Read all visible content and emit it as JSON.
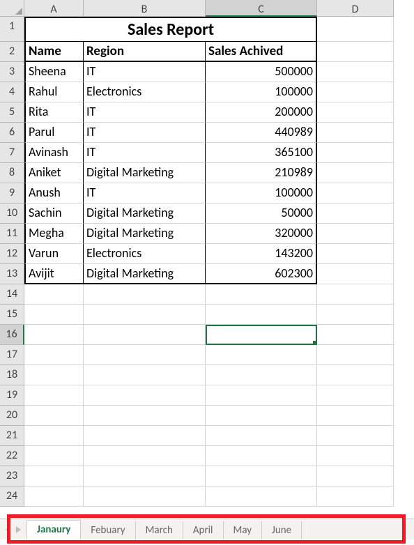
{
  "cols": [
    "A",
    "B",
    "C",
    "D"
  ],
  "title": "Sales Report",
  "headers": {
    "name": "Name",
    "region": "Region",
    "sales": "Sales Achived"
  },
  "rows": [
    {
      "name": "Sheena",
      "region": "IT",
      "sales": "500000"
    },
    {
      "name": "Rahul",
      "region": "Electronics",
      "sales": "100000"
    },
    {
      "name": "Rita",
      "region": "IT",
      "sales": "200000"
    },
    {
      "name": "Parul",
      "region": "IT",
      "sales": "440989"
    },
    {
      "name": "Avinash",
      "region": "IT",
      "sales": "365100"
    },
    {
      "name": "Aniket",
      "region": "Digital Marketing",
      "sales": "210989"
    },
    {
      "name": "Anush",
      "region": "IT",
      "sales": "100000"
    },
    {
      "name": "Sachin",
      "region": "Digital Marketing",
      "sales": "50000"
    },
    {
      "name": "Megha",
      "region": "Digital Marketing",
      "sales": "320000"
    },
    {
      "name": "Varun",
      "region": "Electronics",
      "sales": "143200"
    },
    {
      "name": "Avijit",
      "region": "Digital Marketing",
      "sales": "602300"
    }
  ],
  "tabs": [
    "Janaury",
    "Febuary",
    "March",
    "April",
    "May",
    "June"
  ],
  "activeTab": 0,
  "selectedCell": {
    "row": 16,
    "col": "C"
  },
  "chart_data": {
    "type": "table",
    "title": "Sales Report",
    "columns": [
      "Name",
      "Region",
      "Sales Achived"
    ],
    "data": [
      [
        "Sheena",
        "IT",
        500000
      ],
      [
        "Rahul",
        "Electronics",
        100000
      ],
      [
        "Rita",
        "IT",
        200000
      ],
      [
        "Parul",
        "IT",
        440989
      ],
      [
        "Avinash",
        "IT",
        365100
      ],
      [
        "Aniket",
        "Digital Marketing",
        210989
      ],
      [
        "Anush",
        "IT",
        100000
      ],
      [
        "Sachin",
        "Digital Marketing",
        50000
      ],
      [
        "Megha",
        "Digital Marketing",
        320000
      ],
      [
        "Varun",
        "Electronics",
        143200
      ],
      [
        "Avijit",
        "Digital Marketing",
        602300
      ]
    ]
  }
}
